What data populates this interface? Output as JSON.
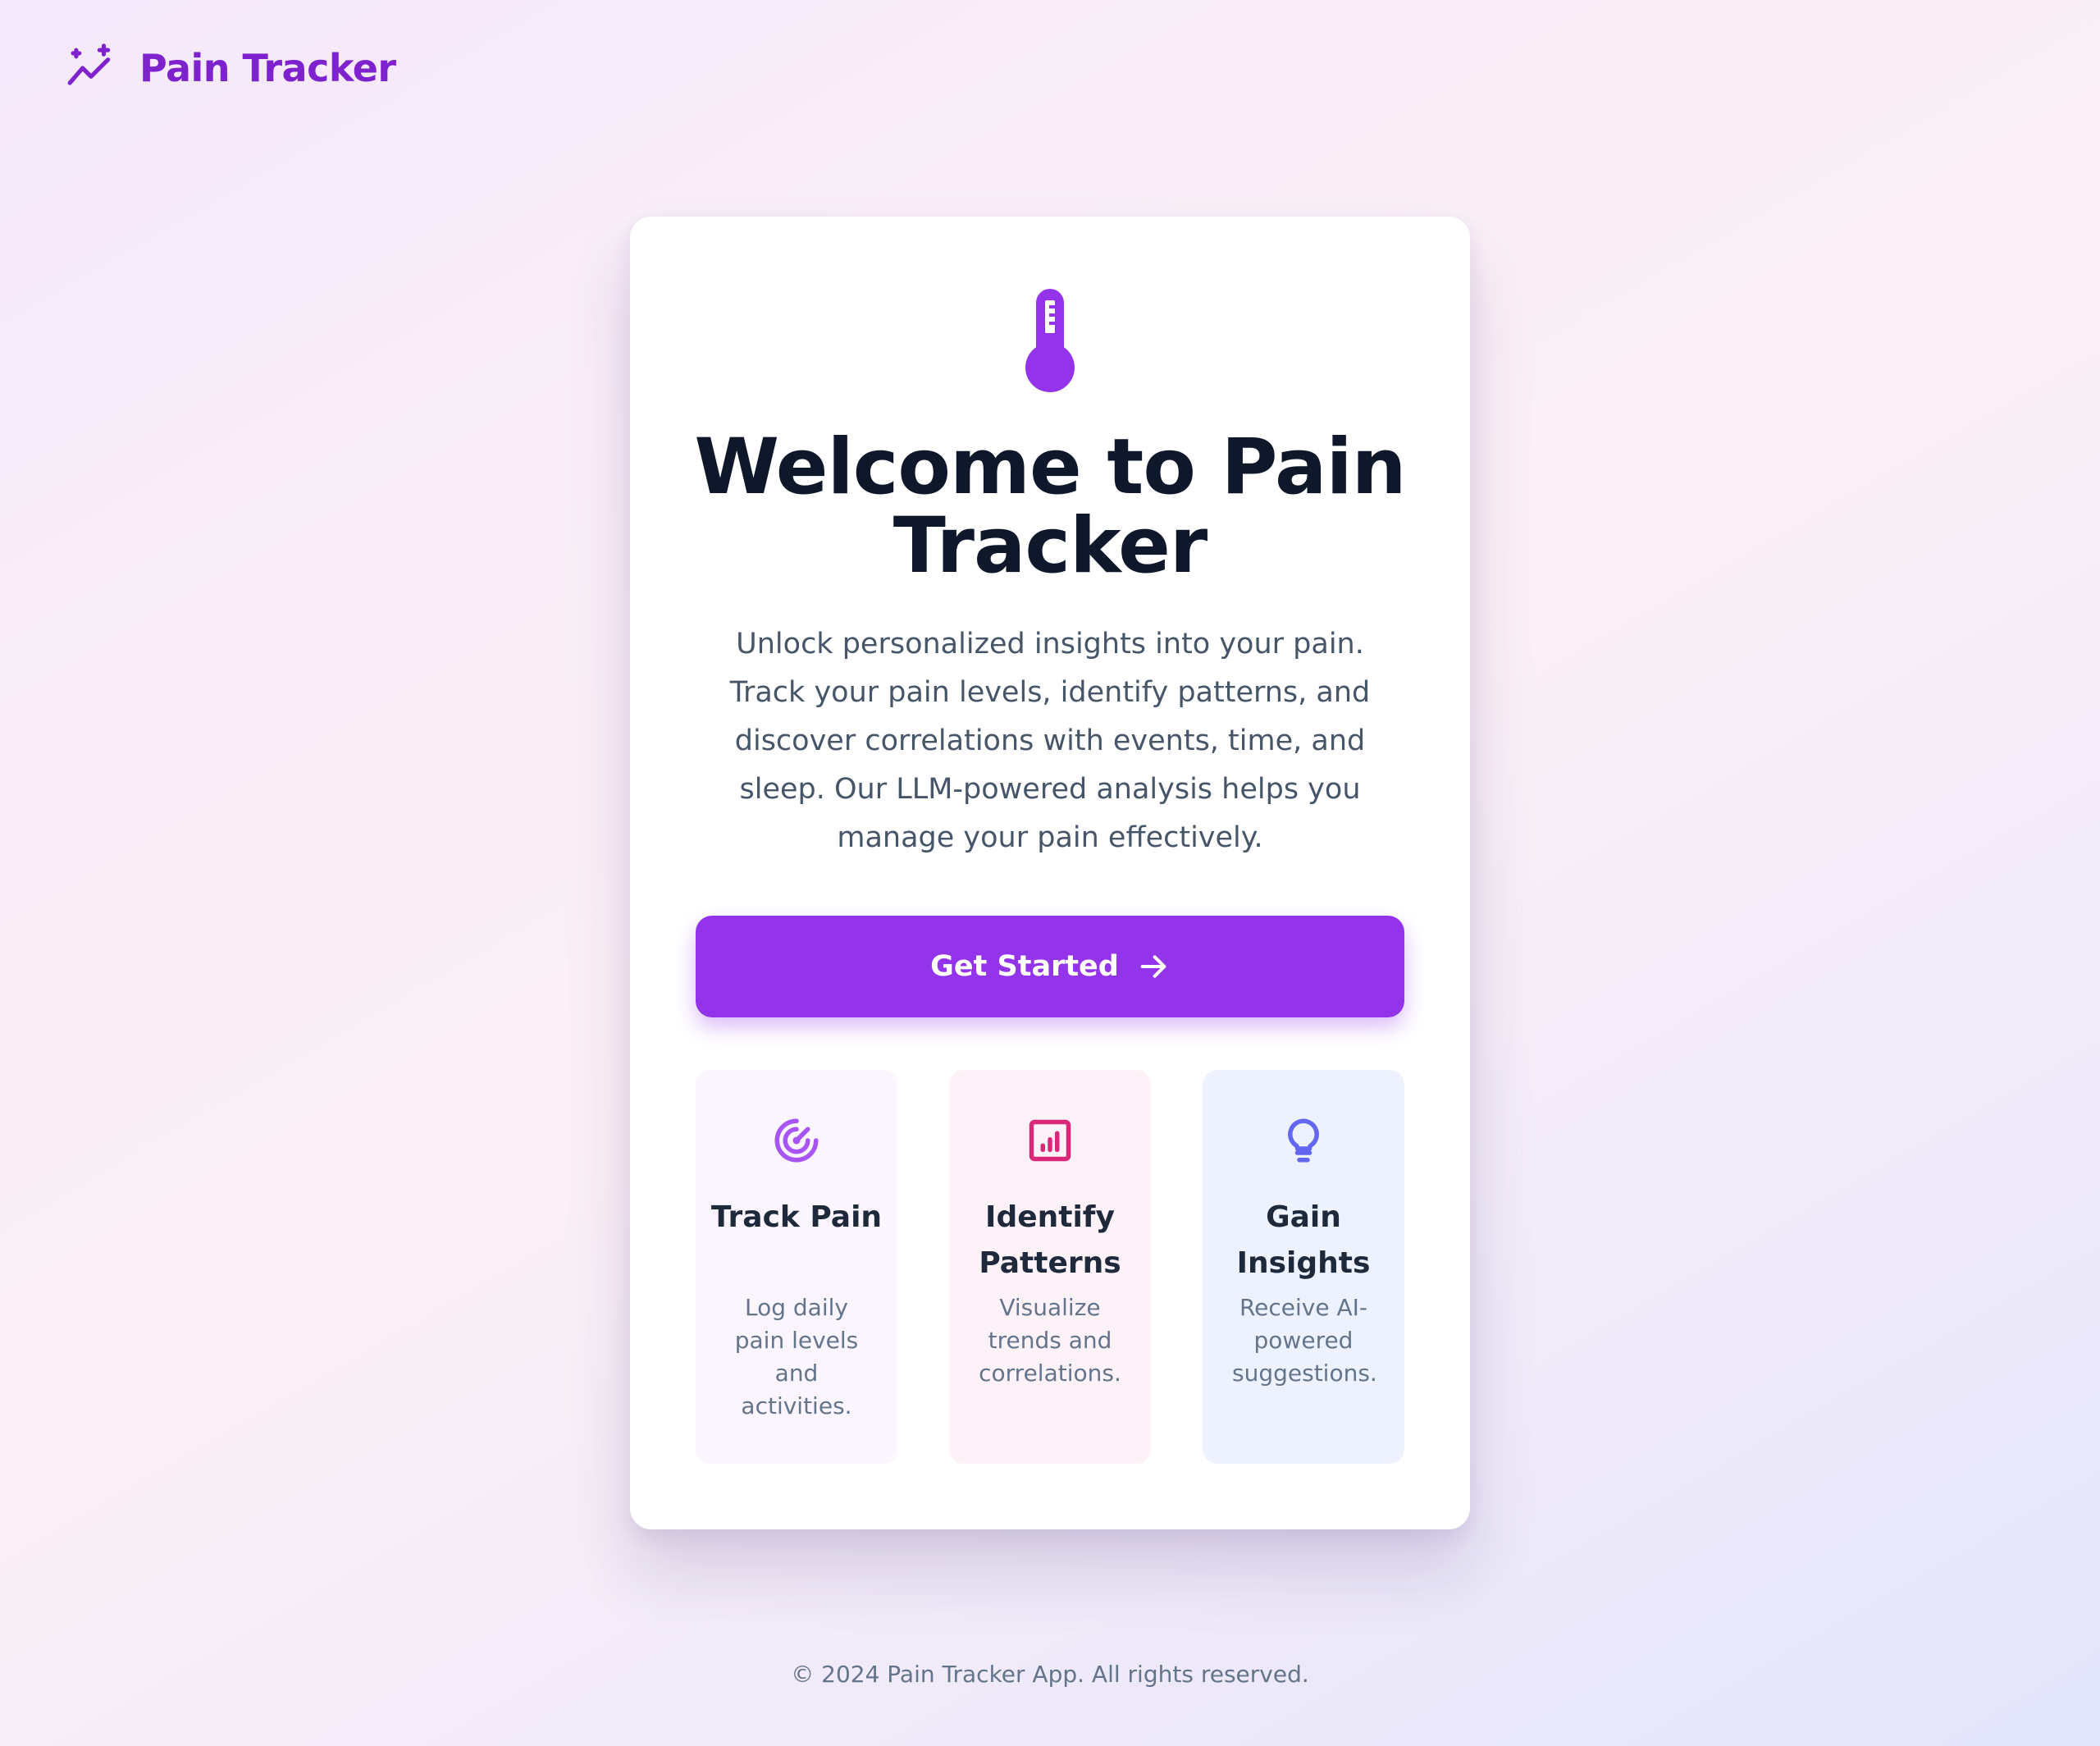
{
  "brand": {
    "name": "Pain Tracker",
    "icon": "sparkle-trend-icon"
  },
  "hero": {
    "icon": "thermometer-icon",
    "title": "Welcome to Pain Tracker",
    "description": "Unlock personalized insights into your pain. Track your pain levels, identify patterns, and discover correlations with events, time, and sleep. Our LLM-powered analysis helps you manage your pain effectively.",
    "cta_label": "Get Started",
    "cta_icon": "arrow-right-icon"
  },
  "features": [
    {
      "icon": "target-icon",
      "title": "Track Pain",
      "description": "Log daily pain levels and activities."
    },
    {
      "icon": "chart-icon",
      "title": "Identify Patterns",
      "description": "Visualize trends and correlations."
    },
    {
      "icon": "lightbulb-icon",
      "title": "Gain Insights",
      "description": "Receive AI-powered suggestions."
    }
  ],
  "footer": {
    "text": "© 2024 Pain Tracker App. All rights reserved."
  },
  "colors": {
    "accent": "#9333ea",
    "brand": "#7e22ce",
    "title": "#0f172a",
    "pink": "#db2777",
    "indigo": "#6366f1"
  }
}
